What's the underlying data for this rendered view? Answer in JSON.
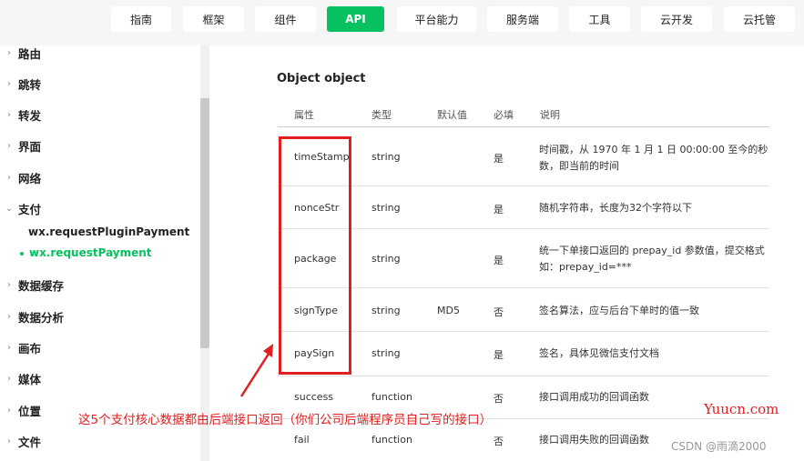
{
  "topnav": {
    "tabs": [
      {
        "label": "指南",
        "active": false
      },
      {
        "label": "框架",
        "active": false
      },
      {
        "label": "组件",
        "active": false
      },
      {
        "label": "API",
        "active": true
      },
      {
        "label": "平台能力",
        "active": false
      },
      {
        "label": "服务端",
        "active": false
      },
      {
        "label": "工具",
        "active": false
      },
      {
        "label": "云开发",
        "active": false
      },
      {
        "label": "云托管",
        "active": false
      }
    ]
  },
  "sidebar": {
    "items": [
      {
        "label": "路由",
        "expanded": false
      },
      {
        "label": "跳转",
        "expanded": false
      },
      {
        "label": "转发",
        "expanded": false
      },
      {
        "label": "界面",
        "expanded": false
      },
      {
        "label": "网络",
        "expanded": false
      },
      {
        "label": "支付",
        "expanded": true
      },
      {
        "label": "数据缓存",
        "expanded": false
      },
      {
        "label": "数据分析",
        "expanded": false
      },
      {
        "label": "画布",
        "expanded": false
      },
      {
        "label": "媒体",
        "expanded": false
      },
      {
        "label": "位置",
        "expanded": false
      },
      {
        "label": "文件",
        "expanded": false
      }
    ],
    "sub_items": [
      {
        "label": "wx.requestPluginPayment",
        "active": false
      },
      {
        "label": "wx.requestPayment",
        "active": true
      }
    ]
  },
  "content": {
    "section_title": "Object object",
    "table": {
      "headers": [
        "属性",
        "类型",
        "默认值",
        "必填",
        "说明"
      ],
      "rows": [
        {
          "name": "timeStamp",
          "type": "string",
          "default": "",
          "required": "是",
          "desc": "时间戳，从 1970 年 1 月 1 日 00:00:00 至今的秒数，即当前的时间"
        },
        {
          "name": "nonceStr",
          "type": "string",
          "default": "",
          "required": "是",
          "desc": "随机字符串，长度为32个字符以下"
        },
        {
          "name": "package",
          "type": "string",
          "default": "",
          "required": "是",
          "desc": "统一下单接口返回的 prepay_id 参数值，提交格式如：prepay_id=***"
        },
        {
          "name": "signType",
          "type": "string",
          "default": "MD5",
          "required": "否",
          "desc": "签名算法，应与后台下单时的值一致"
        },
        {
          "name": "paySign",
          "type": "string",
          "default": "",
          "required": "是",
          "desc": "签名，具体见微信支付文档"
        },
        {
          "name": "success",
          "type": "function",
          "default": "",
          "required": "否",
          "desc": "接口调用成功的回调函数"
        },
        {
          "name": "fail",
          "type": "function",
          "default": "",
          "required": "否",
          "desc": "接口调用失败的回调函数"
        }
      ]
    }
  },
  "annotation": {
    "text": "这5个支付核心数据都由后端接口返回（你们公司后端程序员自己写的接口）",
    "color": "#e02020"
  },
  "watermarks": {
    "site": "Yuucn.com",
    "csdn": "CSDN @雨滴2000"
  },
  "colors": {
    "accent": "#07c160",
    "annotation_red": "#e02020"
  }
}
